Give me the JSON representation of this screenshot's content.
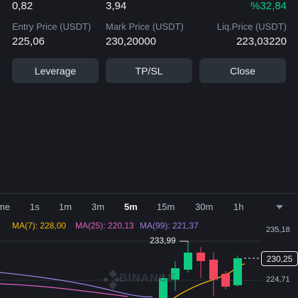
{
  "position": {
    "size_value": "0,82",
    "margin_value": "3,94",
    "roe_value": "%32,84",
    "entry_label": "Entry Price (USDT)",
    "entry_value": "225,06",
    "mark_label": "Mark Price (USDT)",
    "mark_value": "230,20000",
    "liq_label": "Liq.Price (USDT)",
    "liq_value": "223,03220"
  },
  "buttons": {
    "leverage": "Leverage",
    "tpsl": "TP/SL",
    "close": "Close"
  },
  "timeframes": [
    "me",
    "1s",
    "1m",
    "3m",
    "5m",
    "15m",
    "30m",
    "1h"
  ],
  "selected_timeframe": "5m",
  "indicators": {
    "ma7": "MA(7): 228,00",
    "ma25": "MA(25): 220,13",
    "ma99": "MA(99): 221,37"
  },
  "chart": {
    "high_label": "233,99",
    "current_price": "230,25",
    "axis_top": "235,18",
    "axis_mid": "224,71",
    "watermark": "BINANCE"
  },
  "colors": {
    "background": "#181a20",
    "positive": "#0ecb81",
    "negative": "#f6465d",
    "ma7": "#f0b90b",
    "ma25": "#e45fc4",
    "ma99": "#9f7de0"
  }
}
